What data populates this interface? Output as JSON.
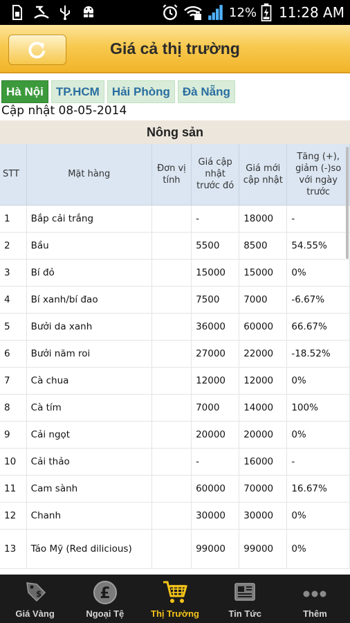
{
  "status_bar": {
    "battery_percent": "12%",
    "time": "11:28 AM",
    "icons": [
      "sim-icon",
      "phone-missed-icon",
      "usb-icon",
      "android-debug-icon",
      "alarm-icon",
      "wifi-icon",
      "signal-icon",
      "battery-icon"
    ]
  },
  "header": {
    "title": "Giá cả thị trường",
    "refresh_icon": "refresh-icon"
  },
  "cities": [
    {
      "label": "Hà Nội",
      "active": true
    },
    {
      "label": "TP.HCM",
      "active": false
    },
    {
      "label": "Hải Phòng",
      "active": false
    },
    {
      "label": "Đà Nẵng",
      "active": false
    }
  ],
  "update_text": "Cập nhật 08-05-2014",
  "section_title": "Nông sản",
  "table": {
    "columns": [
      "STT",
      "Mặt hàng",
      "Đơn vị tính",
      "Giá cập nhật trước đó",
      "Giá mới cập nhật",
      "Tăng (+), giảm (-)so với ngày trước"
    ],
    "rows": [
      [
        "1",
        "Bắp cải trắng",
        "",
        "-",
        "18000",
        "-"
      ],
      [
        "2",
        "Bầu",
        "",
        "5500",
        "8500",
        "54.55%"
      ],
      [
        "3",
        "Bí đỏ",
        "",
        "15000",
        "15000",
        "0%"
      ],
      [
        "4",
        "Bí xanh/bí đao",
        "",
        "7500",
        "7000",
        "-6.67%"
      ],
      [
        "5",
        "Bưởi da xanh",
        "",
        "36000",
        "60000",
        "66.67%"
      ],
      [
        "6",
        "Bưởi năm roi",
        "",
        "27000",
        "22000",
        "-18.52%"
      ],
      [
        "7",
        "Cà chua",
        "",
        "12000",
        "12000",
        "0%"
      ],
      [
        "8",
        "Cà tím",
        "",
        "7000",
        "14000",
        "100%"
      ],
      [
        "9",
        "Cải ngọt",
        "",
        "20000",
        "20000",
        "0%"
      ],
      [
        "10",
        "Cải thảo",
        "",
        "-",
        "16000",
        "-"
      ],
      [
        "11",
        "Cam sành",
        "",
        "60000",
        "70000",
        "16.67%"
      ],
      [
        "12",
        "Chanh",
        "",
        "30000",
        "30000",
        "0%"
      ],
      [
        "13",
        "Táo Mỹ (Red dilicious)",
        "",
        "99000",
        "99000",
        "0%"
      ]
    ]
  },
  "bottom_nav": [
    {
      "label": "Giá Vàng",
      "icon": "gold-tag-icon",
      "active": false
    },
    {
      "label": "Ngoại Tệ",
      "icon": "pound-coin-icon",
      "active": false
    },
    {
      "label": "Thị Trường",
      "icon": "shopping-cart-icon",
      "active": true
    },
    {
      "label": "Tin Tức",
      "icon": "newspaper-icon",
      "active": false
    },
    {
      "label": "Thêm",
      "icon": "more-dots-icon",
      "active": false
    }
  ],
  "colors": {
    "header_gradient_top": "#fde59a",
    "header_gradient_bottom": "#f2b42a",
    "active_tab": "#3c9a3c",
    "tab_text": "#2a6ea0",
    "nav_active": "#f4c31a",
    "nav_background": "#1b1b1b"
  }
}
